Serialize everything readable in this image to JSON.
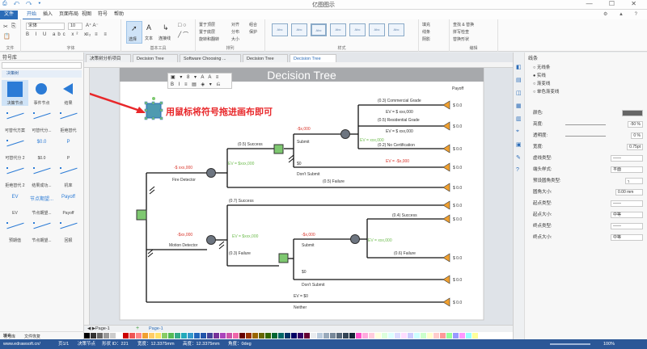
{
  "window": {
    "title": "亿图图示",
    "quick_access": "⎙ ↶ ↷ ▾ ",
    "controls": "— ☐ ✕"
  },
  "menu": {
    "file": "文件",
    "tabs": [
      "开始",
      "插入",
      "页面布局",
      "视图",
      "符号",
      "帮助"
    ],
    "right_icons": "⚙ ▲ ?"
  },
  "ribbon": {
    "groups": {
      "file": "文件",
      "font": "字体",
      "tools": "基本工具",
      "arrange": "排列",
      "style": "样式",
      "edit": "编辑"
    },
    "font_name": "宋体",
    "font_size": "10",
    "tool_buttons": [
      "选择",
      "文本",
      "连接线"
    ],
    "arrange_buttons": [
      "置于顶层",
      "置于底层",
      "旋转和翻转",
      "对齐",
      "分布",
      "大小",
      "组合",
      "保护"
    ],
    "style_labels": [
      "Abc",
      "Abc",
      "Abc",
      "Abc",
      "Abc",
      "Abc",
      "Abc"
    ],
    "fill_buttons": [
      "填充",
      "线条",
      "阴影"
    ],
    "edit_buttons": [
      "查找 & 替换",
      "拼写检查",
      "替换形状"
    ]
  },
  "left_panel": {
    "title": "符号库",
    "category": "决策树",
    "symbols": [
      {
        "label": "决策节点",
        "icon": "square-icon"
      },
      {
        "label": "事件节点",
        "icon": "circle-icon"
      },
      {
        "label": "结果",
        "icon": "triangle-icon"
      },
      {
        "label": "可替代方案",
        "icon": "line-icon"
      },
      {
        "label": "可替代分...",
        "icon": "line-icon"
      },
      {
        "label": "拒绝替代",
        "icon": "line-icon"
      },
      {
        "label": "可替代分 2",
        "icon": "line-icon"
      },
      {
        "label": "$0.0",
        "icon": "text-icon"
      },
      {
        "label": "P",
        "icon": "text-icon"
      },
      {
        "label": "拒绝替代 2",
        "icon": "line-icon"
      },
      {
        "label": "结果成功...",
        "icon": "line-icon"
      },
      {
        "label": "机率",
        "icon": "line-icon"
      },
      {
        "label": "EV",
        "icon": "text-icon"
      },
      {
        "label": "节点期望...",
        "icon": "text-icon"
      },
      {
        "label": "Payoff",
        "icon": "text-icon"
      },
      {
        "label": "预期值",
        "icon": "line-icon"
      },
      {
        "label": "节点期望...",
        "icon": "line-icon"
      },
      {
        "label": "回报",
        "icon": "line-icon"
      }
    ],
    "footer_tabs": [
      "符号库",
      "文件恢复"
    ]
  },
  "doc_tabs": [
    "决策树分析项目",
    "Decision Tree",
    "Software Choosing ...",
    "Decision Tree",
    "Decision Tree"
  ],
  "annotation": "用鼠标将符号拖进画布即可",
  "diagram": {
    "title": "Decision Tree",
    "payoff_header": "Payoff",
    "labels": {
      "fire_detector": "Fire Detector",
      "fire_cost": "-$ xxx,000",
      "motion_detector": "Motion Detector",
      "motion_cost": "-$xx,000",
      "success1": "(0.5) Success",
      "failure1": "(0.5) Failure",
      "submit1": "Submit",
      "submit1_cost": "-$x,000",
      "ev_fire": "EV = $xxx,000",
      "dont_submit1": "Don't Submit",
      "dont_submit1_val": "$0",
      "commercial": "(0.3) Commercial Grade",
      "ev_commercial": "EV = $ xxx,000",
      "residential": "(0.5) Residential Grade",
      "ev_residential": "EV = $ xxx,000",
      "no_cert": "(0.2) No Certification",
      "ev_no_cert": "EV = -$x,000",
      "ev_chance1": "EV = xxx,000",
      "success2": "(0.7) Success",
      "failure2": "(0.3) Failure",
      "ev_motion": "EV = $xxx,000",
      "submit2": "Submit",
      "submit2_cost": "-$x,000",
      "success3": "(0.4) Success",
      "failure3": "(0.6) Failure",
      "ev_chance3": "EV = xxx,000",
      "dont_submit2": "Don't Submit",
      "dont_submit2_val": "$0",
      "ev_neither": "EV = $0",
      "neither": "Neither",
      "payoff": "$ 0.0"
    }
  },
  "right_panel": {
    "title": "线条",
    "line_options": [
      "无线条",
      "实线",
      "渐变线",
      "单色渐变线"
    ],
    "props": [
      {
        "label": "颜色:",
        "value": ""
      },
      {
        "label": "亮度:",
        "value": "-50 %"
      },
      {
        "label": "透明度:",
        "value": "0 %"
      },
      {
        "label": "宽度:",
        "value": "0.75pt"
      },
      {
        "label": "虚线类型:",
        "value": "——"
      },
      {
        "label": "端头样式:",
        "value": "平面"
      },
      {
        "label": "预设圆角类型:",
        "value": "╮"
      },
      {
        "label": "圆角大小:",
        "value": "0.00 mm"
      },
      {
        "label": "起点类型:",
        "value": "——"
      },
      {
        "label": "起点大小:",
        "value": "中等"
      },
      {
        "label": "终点类型:",
        "value": "——"
      },
      {
        "label": "终点大小:",
        "value": "中等"
      }
    ]
  },
  "page_bar": {
    "page_tab": "Page-1",
    "page_tab2": "Page-1",
    "fill_label": "填充"
  },
  "status": {
    "url": "www.edrawsoft.cn/",
    "page": "页1/1",
    "shape": "决策节点",
    "shape_id": "形状 ID：221",
    "width": "宽度：12.3375mm",
    "height": "高度：12.3375mm",
    "angle": "角度：0deg",
    "zoom": "100%"
  },
  "colors": {
    "accent": "#2b6cb8",
    "node_green": "#7ec870",
    "node_gray": "#6d7580",
    "arrow_red": "#e8272a",
    "terminal_orange": "#f0a030",
    "ev_green": "#6cbb4c",
    "cost_red": "#d9362c"
  }
}
